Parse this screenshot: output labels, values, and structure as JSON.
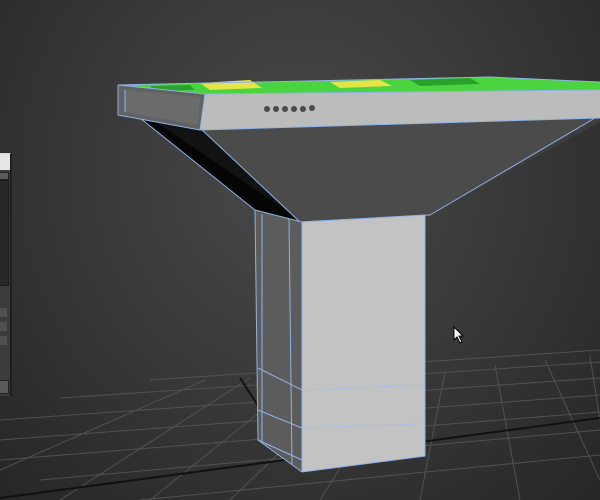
{
  "app": {
    "type": "3d-modeling-viewport"
  },
  "viewport": {
    "background_color": "#3a3a3a",
    "grid_color": "#5a5a5a",
    "mesh_fill_light": "#c9c9c9",
    "mesh_fill_mid": "#757575",
    "mesh_fill_dark": "#4a4a4a",
    "edge_color": "#8fb3e8",
    "top_texture_colors": [
      "#3fd33a",
      "#e6e64a",
      "#2aa12a"
    ]
  },
  "scene": {
    "object": "pedestal",
    "parts": [
      "tabletop",
      "funnel",
      "column"
    ],
    "selected_vertex_dots": 6
  },
  "side_panel": {
    "visible": "partially",
    "icons": [
      "dropdown-icon",
      "spinner-icon"
    ]
  },
  "cursor": {
    "icon": "arrow-cursor-icon"
  }
}
